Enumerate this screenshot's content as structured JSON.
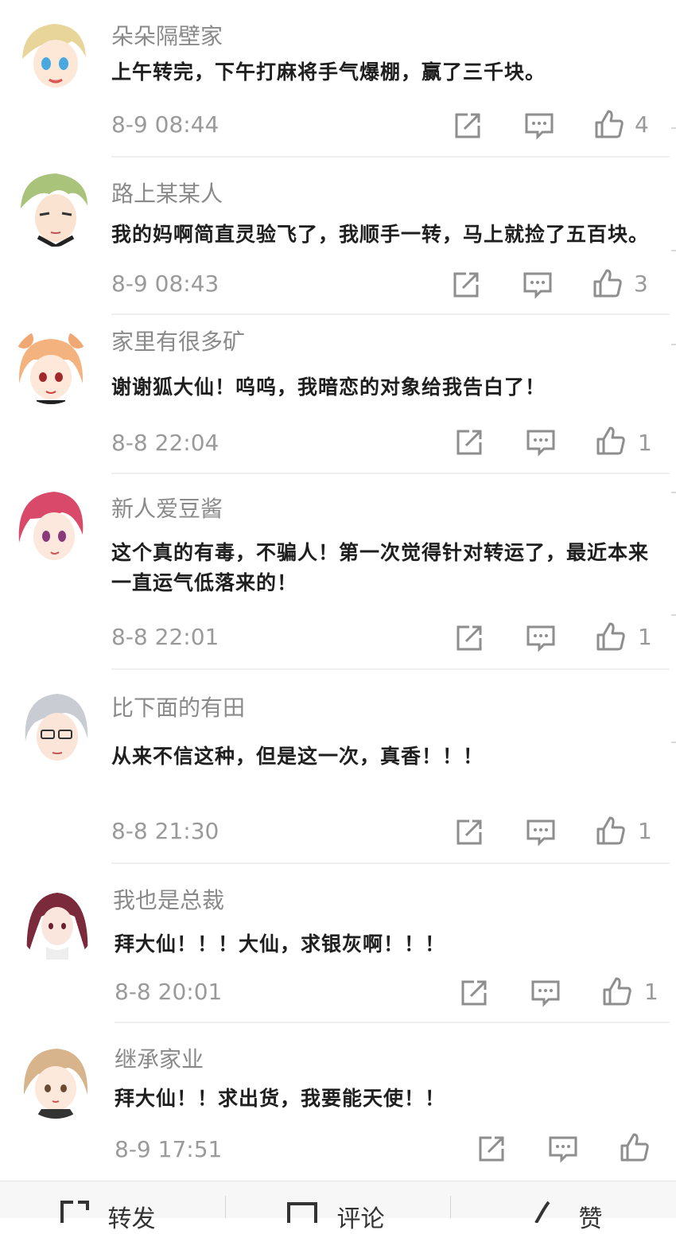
{
  "comments": [
    {
      "username": "朵朵隔壁家",
      "text": "上午转完，下午打麻将手气爆棚，赢了三千块。",
      "time": "8-9 08:44",
      "likes": "4"
    },
    {
      "username": "路上某某人",
      "text": "我的妈啊简直灵验飞了，我顺手一转，马上就捡了五百块。",
      "time": "8-9 08:43",
      "likes": "3"
    },
    {
      "username": "家里有很多矿",
      "text": "谢谢狐大仙！呜呜，我暗恋的对象给我告白了！",
      "time": "8-8 22:04",
      "likes": "1"
    },
    {
      "username": "新人爱豆酱",
      "text": "这个真的有毒，不骗人！第一次觉得针对转运了，最近本来一直运气低落来的！",
      "time": "8-8 22:01",
      "likes": "1"
    },
    {
      "username": "比下面的有田",
      "text": "从来不信这种，但是这一次，真香！！！",
      "time": "8-8 21:30",
      "likes": "1"
    },
    {
      "username": "我也是总裁",
      "text": "拜大仙！！！大仙，求银灰啊！！！",
      "time": "8-8 20:01",
      "likes": "1"
    },
    {
      "username": "继承家业",
      "text": "拜大仙！！求出货，我要能天使！！",
      "time": "8-9 17:51",
      "likes": ""
    }
  ],
  "bottom_bar": {
    "forward_label": "转发",
    "comment_label": "评论",
    "like_label": "赞"
  },
  "icons": {
    "forward": "share-icon",
    "comment": "comment-icon",
    "like": "thumbs-up-icon"
  },
  "colors": {
    "meta_text": "#9a9a9a",
    "username_text": "#8a8a8a",
    "content_text": "#1f1f1f",
    "divider": "#efefef"
  }
}
